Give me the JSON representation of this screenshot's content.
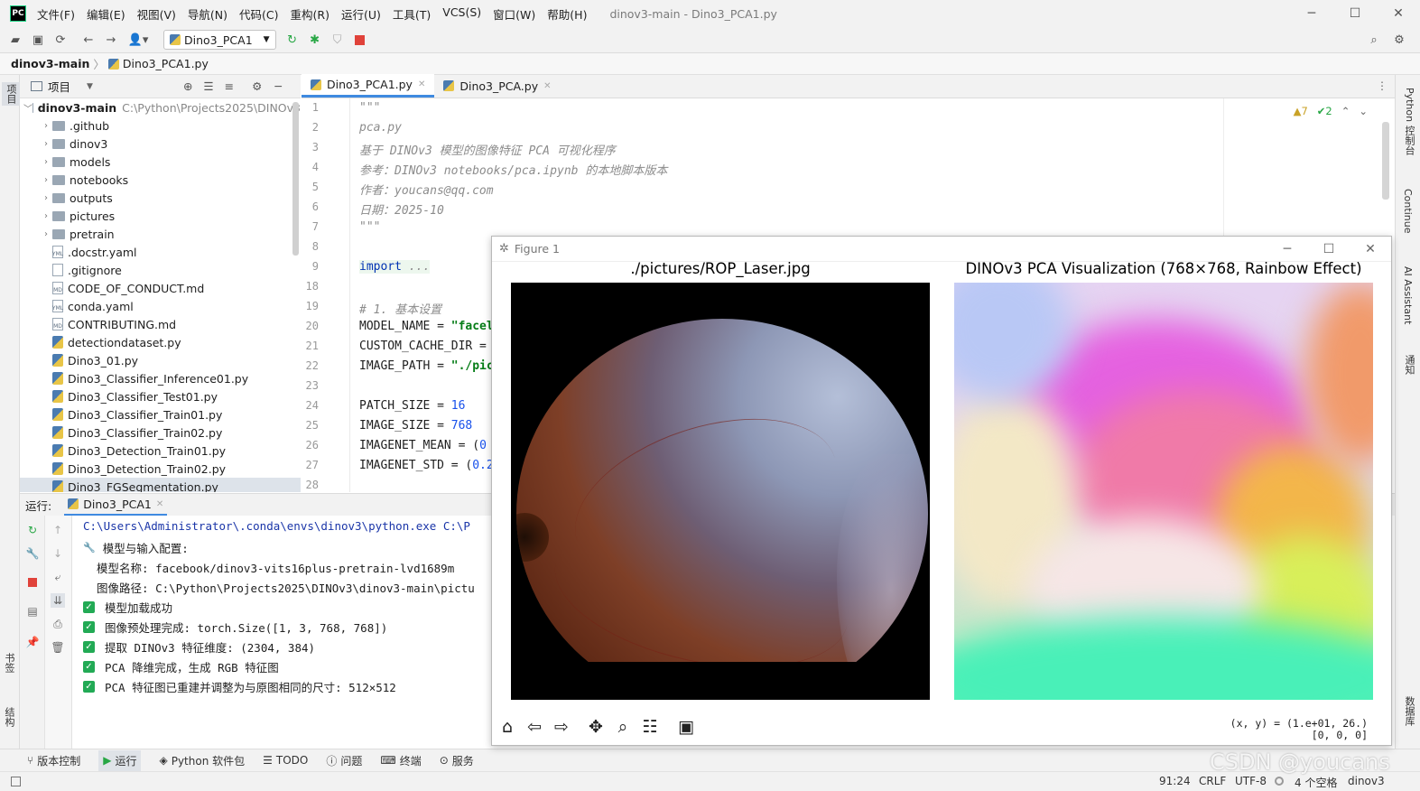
{
  "window": {
    "logo": "PC",
    "menu": [
      "文件(F)",
      "编辑(E)",
      "视图(V)",
      "导航(N)",
      "代码(C)",
      "重构(R)",
      "运行(U)",
      "工具(T)",
      "VCS(S)",
      "窗口(W)",
      "帮助(H)"
    ],
    "title": "dinov3-main - Dino3_PCA1.py"
  },
  "toolbar": {
    "run_config": "Dino3_PCA1"
  },
  "breadcrumb": {
    "project": "dinov3-main",
    "file": "Dino3_PCA1.py"
  },
  "left_stripe": {
    "project_tab": "项目",
    "bookmarks_tab": "书签",
    "structure_tab": "结构"
  },
  "project": {
    "header": "项目",
    "root_name": "dinov3-main",
    "root_path": "C:\\Python\\Projects2025\\DINOv3",
    "items": [
      {
        "name": ".github",
        "type": "folder"
      },
      {
        "name": "dinov3",
        "type": "folder"
      },
      {
        "name": "models",
        "type": "folder"
      },
      {
        "name": "notebooks",
        "type": "folder"
      },
      {
        "name": "outputs",
        "type": "folder"
      },
      {
        "name": "pictures",
        "type": "folder"
      },
      {
        "name": "pretrain",
        "type": "folder"
      },
      {
        "name": ".docstr.yaml",
        "type": "yaml"
      },
      {
        "name": ".gitignore",
        "type": "file"
      },
      {
        "name": "CODE_OF_CONDUCT.md",
        "type": "md"
      },
      {
        "name": "conda.yaml",
        "type": "yaml"
      },
      {
        "name": "CONTRIBUTING.md",
        "type": "md"
      },
      {
        "name": "detectiondataset.py",
        "type": "py"
      },
      {
        "name": "Dino3_01.py",
        "type": "py"
      },
      {
        "name": "Dino3_Classifier_Inference01.py",
        "type": "py"
      },
      {
        "name": "Dino3_Classifier_Test01.py",
        "type": "py"
      },
      {
        "name": "Dino3_Classifier_Train01.py",
        "type": "py"
      },
      {
        "name": "Dino3_Classifier_Train02.py",
        "type": "py"
      },
      {
        "name": "Dino3_Detection_Train01.py",
        "type": "py"
      },
      {
        "name": "Dino3_Detection_Train02.py",
        "type": "py"
      },
      {
        "name": "Dino3_FGSegmentation.py",
        "type": "py"
      }
    ]
  },
  "editor": {
    "tabs": [
      "Dino3_PCA1.py",
      "Dino3_PCA.py"
    ],
    "warnings": "▲7",
    "checks": "✔2",
    "line_numbers": [
      "1",
      "2",
      "3",
      "4",
      "5",
      "6",
      "7",
      "8",
      "9",
      "18",
      "19",
      "20",
      "21",
      "22",
      "23",
      "24",
      "25",
      "26",
      "27",
      "28"
    ],
    "lines": [
      {
        "parts": [
          {
            "t": "\"\"\"",
            "c": "doc"
          }
        ]
      },
      {
        "parts": [
          {
            "t": "pca.py",
            "c": "doc"
          }
        ]
      },
      {
        "parts": [
          {
            "t": "基于 DINOv3 模型的图像特征 PCA 可视化程序",
            "c": "doc"
          }
        ]
      },
      {
        "parts": [
          {
            "t": "参考：DINOv3 notebooks/pca.ipynb 的本地脚本版本",
            "c": "doc"
          }
        ]
      },
      {
        "parts": [
          {
            "t": "作者：youcans@qq.com",
            "c": "doc"
          }
        ]
      },
      {
        "parts": [
          {
            "t": "日期：2025-10",
            "c": "doc"
          }
        ]
      },
      {
        "parts": [
          {
            "t": "\"\"\"",
            "c": "doc"
          }
        ]
      },
      {
        "parts": []
      },
      {
        "parts": [
          {
            "t": "import",
            "c": "kw"
          },
          {
            "t": " ...",
            "c": "cmt"
          }
        ]
      },
      {
        "parts": []
      },
      {
        "parts": [
          {
            "t": "# 1. 基本设置",
            "c": "cmt"
          }
        ]
      },
      {
        "parts": [
          {
            "t": "MODEL_NAME = ",
            "c": ""
          },
          {
            "t": "\"facel",
            "c": "str"
          }
        ]
      },
      {
        "parts": [
          {
            "t": "CUSTOM_CACHE_DIR =",
            "c": ""
          }
        ]
      },
      {
        "parts": [
          {
            "t": "IMAGE_PATH = ",
            "c": ""
          },
          {
            "t": "\"./pic",
            "c": "str"
          }
        ]
      },
      {
        "parts": []
      },
      {
        "parts": [
          {
            "t": "PATCH_SIZE = ",
            "c": ""
          },
          {
            "t": "16",
            "c": "num"
          }
        ]
      },
      {
        "parts": [
          {
            "t": "IMAGE_SIZE = ",
            "c": ""
          },
          {
            "t": "768",
            "c": "num"
          }
        ]
      },
      {
        "parts": [
          {
            "t": "IMAGENET_MEAN = (",
            "c": ""
          },
          {
            "t": "0",
            "c": "num"
          }
        ]
      },
      {
        "parts": [
          {
            "t": "IMAGENET_STD = (",
            "c": ""
          },
          {
            "t": "0.2",
            "c": "num"
          }
        ]
      },
      {
        "parts": []
      }
    ]
  },
  "right_stripe": {
    "tabs": [
      "Python 控制台",
      "Continue",
      "AI Assistant",
      "通知",
      "数据库"
    ]
  },
  "run": {
    "label": "运行:",
    "tab": "Dino3_PCA1",
    "console": [
      {
        "text": "C:\\Users\\Administrator\\.conda\\envs\\dinov3\\python.exe C:\\P",
        "style": "path"
      },
      {
        "text": "模型与输入配置:",
        "style": "wrench"
      },
      {
        "text": "  模型名称: facebook/dinov3-vits16plus-pretrain-lvd1689m",
        "style": "plain"
      },
      {
        "text": "  图像路径: C:\\Python\\Projects2025\\DINOv3\\dinov3-main\\pictu",
        "style": "plain"
      },
      {
        "text": "模型加载成功",
        "style": "check"
      },
      {
        "text": "图像预处理完成: torch.Size([1, 3, 768, 768])",
        "style": "check"
      },
      {
        "text": "提取 DINOv3 特征维度: (2304, 384)",
        "style": "check"
      },
      {
        "text": "PCA 降维完成，生成 RGB 特征图",
        "style": "check"
      },
      {
        "text": "PCA 特征图已重建并调整为与原图相同的尺寸: 512×512",
        "style": "check"
      }
    ]
  },
  "bottom_tools": [
    "版本控制",
    "运行",
    "Python 软件包",
    "TODO",
    "问题",
    "终端",
    "服务"
  ],
  "status": {
    "position": "91:24",
    "line_sep": "CRLF",
    "encoding": "UTF-8",
    "indent": "4 个空格",
    "interpreter": "dinov3"
  },
  "figure": {
    "title": "Figure 1",
    "left_title": "./pictures/ROP_Laser.jpg",
    "right_title": "DINOv3 PCA Visualization (768×768, Rainbow Effect)",
    "coords_line1": "(x, y) = (1.e+01, 26.)",
    "coords_line2": "[0, 0, 0]"
  },
  "watermark": "CSDN @youcans"
}
